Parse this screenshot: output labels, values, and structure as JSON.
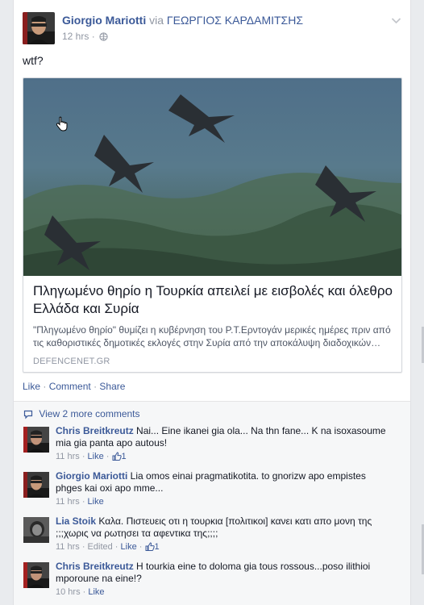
{
  "post": {
    "author": "Giorgio Mariotti",
    "via": "via",
    "via_author": "ΓΕΩΡΓΙΟΣ ΚΑΡΔΑΜΙΤΣΗΣ",
    "time": "12 hrs",
    "separator": "·",
    "privacy_icon": "globe-icon",
    "menu_icon": "chevron-down-icon",
    "message": "wtf?"
  },
  "link_card": {
    "image_desc_icon": "fighter-jets-photo",
    "title": "Πληγωμένο θηρίο η Τουρκία απειλεί με εισβολές και όλεθρο Ελλάδα και Συρία",
    "description": "\"Πληγωμένο θηρίο\" θυμίζει η κυβέρνηση του Ρ.Τ.Ερντογάν μερικές ημέρες πριν από τις καθοριστικές δημοτικές εκλογές στην Συρία από την αποκάλυψη διαδοχικών…",
    "source": "DEFENCENET.GR"
  },
  "actions": {
    "like": "Like",
    "comment": "Comment",
    "share": "Share",
    "dot": "·"
  },
  "comments_section": {
    "view_more": "View 2 more comments",
    "items": [
      {
        "name": "Chris Breitkreutz",
        "text": "Nai... Eine ikanei gia ola... Na thn fane... K na isoxasoume mia gia panta apo autous!",
        "time": "11 hrs",
        "like": "Like",
        "likes": "1"
      },
      {
        "name": "Giorgio Mariotti",
        "text": "Lia omos einai pragmatikotita. to gnorizw apo empistes phges kai oxi apo mme...",
        "time": "11 hrs",
        "like": "Like"
      },
      {
        "name": "Lia Stoik",
        "text": "Καλα. Πιστευεις οτι η τουρκια [πολιτικοι] κανει κατι απο μονη της ;;;χωρις να ρωτησει τα αφεντικα της;;;;",
        "time": "11 hrs",
        "edited": "Edited",
        "like": "Like",
        "likes": "1"
      },
      {
        "name": "Chris Breitkreutz",
        "text": "H tourkia eine to doloma gia tous rossous...poso ilithioi mporoune na eine!?",
        "time": "10 hrs",
        "like": "Like"
      }
    ]
  },
  "colors": {
    "link": "#3b5998",
    "meta": "#9197a3",
    "comment_bg": "#f6f7f8"
  }
}
